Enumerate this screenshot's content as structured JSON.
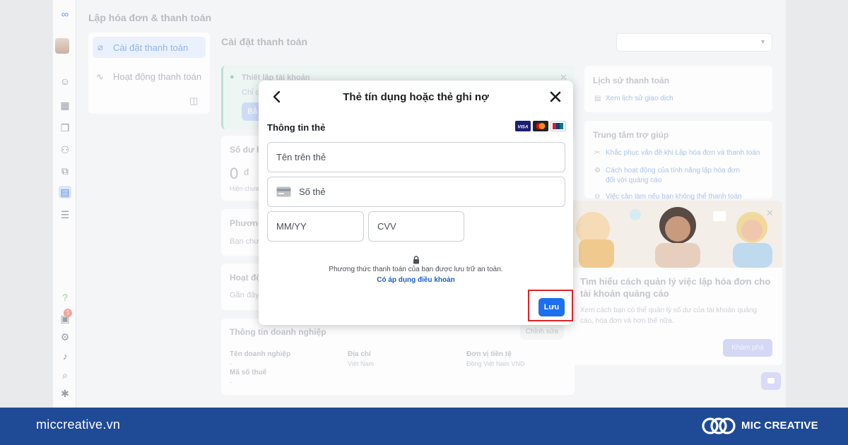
{
  "page": {
    "title": "Lập hóa đơn & thanh toán",
    "section_title": "Cài đặt thanh toán"
  },
  "sidebar": {
    "items": [
      {
        "label": "Cài đặt thanh toán",
        "icon": "tag-icon",
        "active": true
      },
      {
        "label": "Hoạt động thanh toán",
        "icon": "activity-icon",
        "active": false
      }
    ]
  },
  "background": {
    "setup_notice": {
      "title": "Thiết lập tài khoản",
      "text": "Chỉ c",
      "button": "Bắ"
    },
    "balance": {
      "title": "Số dư h",
      "amount": "0",
      "currency": "đ",
      "caption": "Hiện chưa"
    },
    "method": {
      "title": "Phương",
      "text": "Bạn chưa"
    },
    "activity": {
      "title": "Hoạt độ",
      "text": "Gần đây l"
    },
    "business": {
      "title": "Thông tin doanh nghiệp",
      "edit": "Chỉnh sửa",
      "fields": [
        {
          "label": "Tên doanh nghiệp",
          "value": "-"
        },
        {
          "label": "Địa chỉ",
          "value": "Việt Nam"
        },
        {
          "label": "Đơn vị tiền tệ",
          "value": "Đồng Việt Nam VND"
        },
        {
          "label": "Mã số thuế",
          "value": "-"
        }
      ]
    },
    "history": {
      "title": "Lịch sử thanh toán",
      "link": "Xem lịch sử giao dịch"
    },
    "help": {
      "title": "Trung tâm trợ giúp",
      "links": [
        "Khắc phục vấn đề khi Lập hóa đơn và thanh toán",
        "Cách hoạt động của tính năng lập hóa đơn đối với quảng cáo",
        "Việc cần làm nếu bạn không thể thanh toán"
      ]
    },
    "promo": {
      "title": "Tìm hiểu cách quản lý việc lập hóa đơn cho tài khoản quảng cáo",
      "desc": "Xem cách bạn có thể quản lý số dư của tài khoản quảng cáo, hóa đơn và hơn thế nữa.",
      "button": "Khám phá"
    },
    "rail_badge": "1"
  },
  "modal": {
    "title": "Thẻ tín dụng hoặc thẻ ghi nợ",
    "section": "Thông tin thẻ",
    "card_brands": [
      "VISA",
      "Mastercard",
      "UnionPay"
    ],
    "fields": {
      "name_placeholder": "Tên trên thẻ",
      "number_placeholder": "Số thẻ",
      "expiry_placeholder": "MM/YY",
      "cvv_placeholder": "CVV"
    },
    "secure_text": "Phương thức thanh toán của bạn được lưu trữ an toàn.",
    "terms_link": "Có áp dụng điều khoản",
    "save_label": "Lưu"
  },
  "footer": {
    "site": "miccreative.vn",
    "brand": "MIC CREATIVE"
  },
  "colors": {
    "primary_button": "#1b6ff0",
    "link": "#1b5fc5",
    "highlight": "#e0242a",
    "footer": "#1f4a96"
  }
}
